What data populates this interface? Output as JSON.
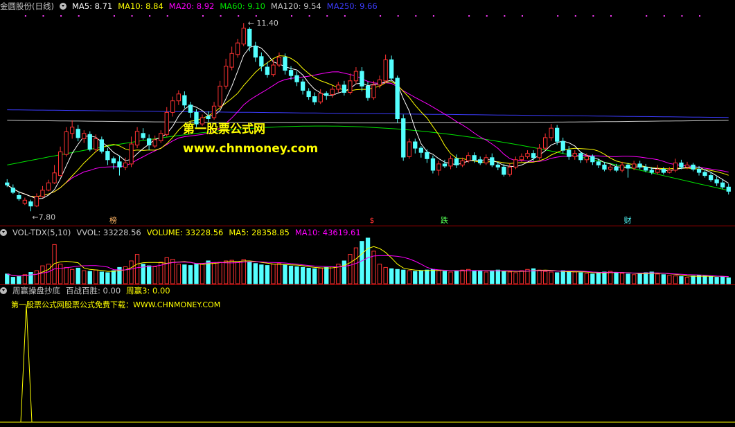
{
  "main_header": {
    "title": "金圆股份(日线)",
    "ma5": "MA5: 8.71",
    "ma10": "MA10: 8.84",
    "ma20": "MA20: 8.92",
    "ma60": "MA60: 9.10",
    "ma120": "MA120: 9.54",
    "ma250": "MA250: 9.66"
  },
  "vol_header": {
    "title": "VOL-TDX(5,10)",
    "vvol": "VVOL: 33228.56",
    "volume": "VOLUME: 33228.56",
    "ma5": "MA5: 28358.85",
    "ma10": "MA10: 43619.61"
  },
  "ind_header": {
    "title": "周赢操盘抄底",
    "bzbs": "百战百胜: 0.00",
    "zy3": "周赢3: 0.00"
  },
  "watermark": {
    "line1": "第一股票公式网",
    "line2": "www.chnmoney.com",
    "line3": "第一股票公式网股票公式免费下载：WWW.CHNMONEY.COM"
  },
  "markers": [
    "榜",
    "$",
    "跌",
    "财"
  ],
  "colors": {
    "up": "#ff3232",
    "down": "#54ffff",
    "ma5": "#ffffff",
    "ma10": "#ffff00",
    "ma20": "#ff00ff",
    "ma60": "#00e600",
    "ma120": "#c8c8c8",
    "ma250": "#3c3cff",
    "grid": "#a00000"
  },
  "chart_data": [
    {
      "type": "candlestick",
      "title": "金圆股份(日线)",
      "annotations": [
        {
          "label": "11.40",
          "type": "high"
        },
        {
          "label": "7.80",
          "type": "low"
        }
      ],
      "price_range": [
        7.6,
        11.6
      ],
      "candles": [
        [
          8.36,
          8.32,
          8.43,
          8.28
        ],
        [
          8.26,
          8.18,
          8.33,
          8.15
        ],
        [
          8.12,
          8.06,
          8.2,
          8.02
        ],
        [
          7.97,
          8.03,
          8.08,
          7.94
        ],
        [
          8.0,
          7.92,
          8.04,
          7.82
        ],
        [
          7.92,
          8.1,
          8.16,
          7.9
        ],
        [
          8.1,
          8.22,
          8.3,
          8.08
        ],
        [
          8.22,
          8.36,
          8.42,
          8.2
        ],
        [
          8.36,
          8.55,
          8.7,
          8.34
        ],
        [
          8.5,
          8.95,
          9.05,
          8.48
        ],
        [
          8.9,
          9.33,
          9.42,
          8.86
        ],
        [
          9.3,
          9.42,
          9.55,
          9.2
        ],
        [
          9.38,
          9.22,
          9.46,
          9.15
        ],
        [
          9.2,
          9.3,
          9.36,
          9.12
        ],
        [
          9.28,
          9.0,
          9.34,
          8.96
        ],
        [
          9.0,
          9.2,
          9.28,
          8.94
        ],
        [
          9.18,
          8.96,
          9.24,
          8.92
        ],
        [
          8.96,
          8.8,
          9.02,
          8.7
        ],
        [
          8.82,
          8.74,
          8.86,
          8.62
        ],
        [
          8.76,
          8.66,
          8.88,
          8.5
        ],
        [
          8.66,
          8.74,
          8.84,
          8.6
        ],
        [
          8.72,
          9.1,
          9.24,
          8.66
        ],
        [
          9.08,
          9.34,
          9.42,
          9.02
        ],
        [
          9.3,
          9.22,
          9.4,
          9.18
        ],
        [
          9.2,
          9.08,
          9.28,
          8.98
        ],
        [
          9.06,
          9.18,
          9.26,
          9.02
        ],
        [
          9.16,
          9.3,
          9.36,
          9.12
        ],
        [
          9.28,
          9.7,
          9.8,
          9.24
        ],
        [
          9.7,
          9.92,
          10.0,
          9.62
        ],
        [
          9.92,
          10.05,
          10.12,
          9.84
        ],
        [
          10.02,
          9.84,
          10.1,
          9.78
        ],
        [
          9.84,
          9.7,
          9.9,
          9.6
        ],
        [
          9.7,
          9.48,
          9.76,
          9.4
        ],
        [
          9.48,
          9.6,
          9.66,
          9.44
        ],
        [
          9.62,
          9.58,
          9.72,
          9.52
        ],
        [
          9.6,
          9.82,
          9.9,
          9.56
        ],
        [
          9.82,
          10.2,
          10.3,
          9.78
        ],
        [
          10.2,
          10.58,
          10.72,
          10.14
        ],
        [
          10.56,
          10.82,
          10.95,
          10.5
        ],
        [
          10.8,
          11.02,
          11.1,
          10.74
        ],
        [
          11.0,
          11.3,
          11.4,
          10.96
        ],
        [
          11.28,
          10.96,
          11.32,
          10.86
        ],
        [
          10.96,
          10.75,
          11.04,
          10.66
        ],
        [
          10.76,
          10.58,
          10.84,
          10.48
        ],
        [
          10.56,
          10.42,
          10.66,
          10.36
        ],
        [
          10.42,
          10.6,
          10.7,
          10.38
        ],
        [
          10.6,
          10.75,
          10.84,
          10.56
        ],
        [
          10.75,
          10.5,
          10.82,
          10.42
        ],
        [
          10.5,
          10.4,
          10.58,
          10.32
        ],
        [
          10.4,
          10.28,
          10.48,
          10.2
        ],
        [
          10.28,
          10.12,
          10.34,
          10.04
        ],
        [
          10.1,
          10.0,
          10.16,
          9.94
        ],
        [
          10.0,
          9.9,
          10.08,
          9.84
        ],
        [
          9.9,
          10.06,
          10.14,
          9.86
        ],
        [
          10.06,
          10.02,
          10.1,
          9.94
        ],
        [
          10.04,
          10.14,
          10.2,
          9.98
        ],
        [
          10.14,
          10.22,
          10.28,
          10.08
        ],
        [
          10.22,
          10.08,
          10.3,
          10.02
        ],
        [
          10.08,
          10.3,
          10.44,
          10.04
        ],
        [
          10.3,
          10.48,
          10.56,
          10.24
        ],
        [
          10.48,
          10.2,
          10.56,
          10.1
        ],
        [
          10.2,
          9.98,
          10.28,
          9.92
        ],
        [
          9.98,
          10.22,
          10.3,
          9.94
        ],
        [
          10.22,
          10.32,
          10.4,
          10.16
        ],
        [
          10.3,
          10.7,
          10.8,
          10.26
        ],
        [
          10.7,
          10.35,
          10.78,
          10.3
        ],
        [
          10.35,
          9.58,
          10.4,
          9.5
        ],
        [
          9.58,
          8.85,
          9.66,
          8.78
        ],
        [
          8.86,
          9.14,
          9.2,
          8.82
        ],
        [
          9.14,
          9.02,
          9.2,
          8.92
        ],
        [
          9.02,
          8.94,
          9.06,
          8.84
        ],
        [
          8.94,
          8.82,
          9.0,
          8.74
        ],
        [
          8.82,
          8.6,
          8.88,
          8.54
        ],
        [
          8.6,
          8.72,
          8.78,
          8.5
        ],
        [
          8.72,
          8.68,
          8.8,
          8.64
        ],
        [
          8.68,
          8.82,
          8.88,
          8.62
        ],
        [
          8.82,
          8.7,
          8.9,
          8.64
        ],
        [
          8.7,
          8.78,
          8.84,
          8.66
        ],
        [
          8.78,
          8.88,
          8.94,
          8.74
        ],
        [
          8.88,
          8.8,
          8.94,
          8.74
        ],
        [
          8.8,
          8.74,
          8.86,
          8.7
        ],
        [
          8.74,
          8.84,
          8.9,
          8.7
        ],
        [
          8.84,
          8.7,
          8.92,
          8.66
        ],
        [
          8.7,
          8.66,
          8.76,
          8.6
        ],
        [
          8.66,
          8.52,
          8.72,
          8.48
        ],
        [
          8.52,
          8.66,
          8.74,
          8.48
        ],
        [
          8.66,
          8.8,
          8.86,
          8.62
        ],
        [
          8.8,
          8.86,
          8.92,
          8.76
        ],
        [
          8.86,
          8.92,
          8.98,
          8.82
        ],
        [
          8.92,
          8.84,
          8.98,
          8.78
        ],
        [
          8.84,
          9.02,
          9.1,
          8.8
        ],
        [
          9.02,
          9.22,
          9.3,
          8.98
        ],
        [
          9.22,
          9.4,
          9.48,
          9.16
        ],
        [
          9.4,
          9.15,
          9.46,
          9.08
        ],
        [
          9.15,
          8.98,
          9.22,
          8.92
        ],
        [
          8.98,
          8.86,
          9.06,
          8.8
        ],
        [
          8.86,
          8.92,
          8.98,
          8.8
        ],
        [
          8.92,
          8.8,
          8.96,
          8.74
        ],
        [
          8.8,
          8.86,
          8.92,
          8.74
        ],
        [
          8.86,
          8.76,
          8.9,
          8.7
        ],
        [
          8.76,
          8.7,
          8.82,
          8.64
        ],
        [
          8.7,
          8.62,
          8.76,
          8.58
        ],
        [
          8.62,
          8.66,
          8.72,
          8.58
        ],
        [
          8.66,
          8.6,
          8.72,
          8.56
        ],
        [
          8.6,
          8.7,
          8.76,
          8.56
        ],
        [
          8.7,
          8.64,
          8.74,
          8.46
        ],
        [
          8.64,
          8.72,
          8.78,
          8.6
        ],
        [
          8.72,
          8.66,
          8.78,
          8.62
        ],
        [
          8.66,
          8.6,
          8.72,
          8.56
        ],
        [
          8.6,
          8.56,
          8.66,
          8.52
        ],
        [
          8.56,
          8.62,
          8.7,
          8.52
        ],
        [
          8.62,
          8.56,
          8.66,
          8.52
        ],
        [
          8.56,
          8.6,
          8.66,
          8.54
        ],
        [
          8.6,
          8.74,
          8.82,
          8.56
        ],
        [
          8.74,
          8.66,
          8.8,
          8.62
        ],
        [
          8.66,
          8.7,
          8.76,
          8.62
        ],
        [
          8.7,
          8.62,
          8.74,
          8.58
        ],
        [
          8.62,
          8.56,
          8.68,
          8.5
        ],
        [
          8.56,
          8.5,
          8.62,
          8.46
        ],
        [
          8.5,
          8.42,
          8.56,
          8.38
        ],
        [
          8.42,
          8.36,
          8.48,
          8.3
        ],
        [
          8.36,
          8.28,
          8.42,
          8.24
        ],
        [
          8.28,
          8.2,
          8.34,
          8.14
        ]
      ]
    },
    {
      "type": "bar",
      "title": "VOL-TDX(5,10)",
      "series": [
        {
          "name": "VOLUME",
          "values": [
            30,
            20,
            22,
            28,
            35,
            40,
            55,
            60,
            120,
            60,
            50,
            44,
            48,
            40,
            38,
            42,
            36,
            34,
            40,
            50,
            52,
            70,
            90,
            60,
            55,
            52,
            66,
            80,
            75,
            60,
            58,
            56,
            60,
            62,
            70,
            64,
            66,
            70,
            72,
            68,
            74,
            66,
            62,
            58,
            56,
            60,
            62,
            58,
            54,
            52,
            50,
            48,
            46,
            48,
            50,
            52,
            60,
            70,
            90,
            110,
            130,
            140,
            100,
            60,
            50,
            46,
            44,
            42,
            40,
            38,
            40,
            42,
            44,
            40,
            38,
            36,
            40,
            42,
            44,
            40,
            38,
            36,
            40,
            42,
            38,
            36,
            34,
            40,
            44,
            46,
            42,
            38,
            36,
            34,
            40,
            38,
            36,
            34,
            32,
            30,
            34,
            36,
            38,
            34,
            32,
            30,
            28,
            32,
            34,
            36,
            30,
            28,
            26,
            24,
            22,
            20,
            24,
            26,
            24,
            22,
            20,
            22,
            18
          ]
        },
        {
          "name": "MA5",
          "values": [
            28358.85
          ]
        },
        {
          "name": "MA10",
          "values": [
            43619.61
          ]
        }
      ]
    },
    {
      "type": "line",
      "title": "周赢操盘抄底",
      "series": [
        {
          "name": "百战百胜",
          "values": [
            0,
            0,
            0,
            0,
            0,
            0,
            0,
            0,
            0,
            0,
            0,
            0,
            0,
            0,
            0,
            0,
            0,
            0,
            0,
            1,
            0,
            0,
            0,
            0,
            0,
            0
          ]
        }
      ]
    }
  ]
}
